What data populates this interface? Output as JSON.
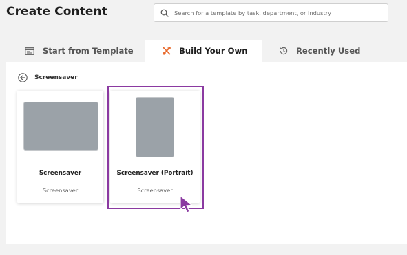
{
  "header": {
    "title": "Create Content",
    "search_placeholder": "Search for a template by task, department, or industry"
  },
  "tabs": [
    {
      "label": "Start from Template",
      "icon": "template-icon",
      "active": false
    },
    {
      "label": "Build Your Own",
      "icon": "tools-icon",
      "active": true
    },
    {
      "label": "Recently Used",
      "icon": "history-icon",
      "active": false
    }
  ],
  "breadcrumb": {
    "label": "Screensaver",
    "icon": "back-arrow-icon"
  },
  "cards": [
    {
      "name": "Screensaver",
      "subtitle": "Screensaver",
      "orientation": "landscape"
    },
    {
      "name": "Screensaver (Portrait)",
      "subtitle": "Screensaver",
      "orientation": "portrait",
      "highlighted": true
    }
  ],
  "colors": {
    "accent_orange": "#e8682a",
    "highlight_purple": "#8b3aa1",
    "thumbnail_gray": "#9ba2a8"
  }
}
